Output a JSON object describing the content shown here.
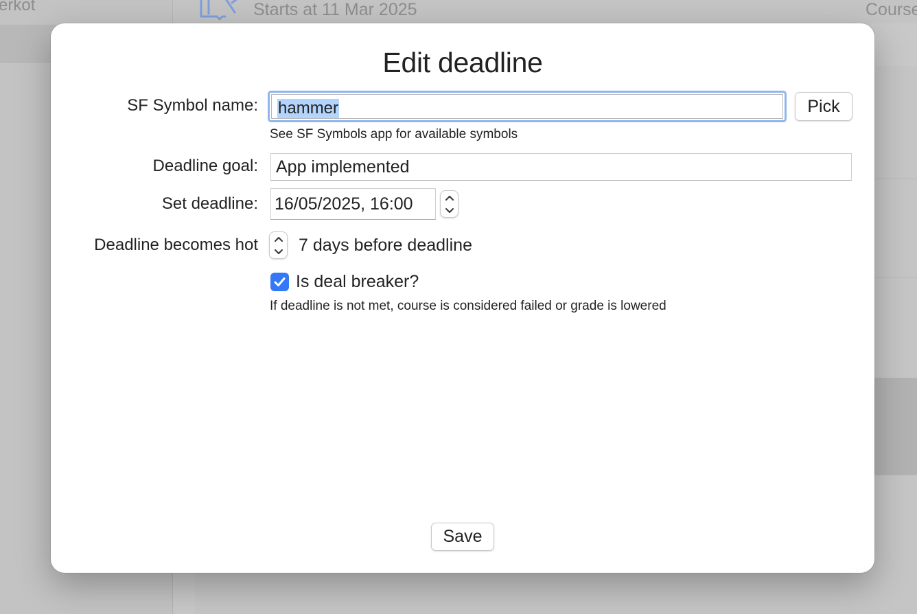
{
  "background": {
    "sidebar_text": "erkot",
    "starts_text": "Starts at 11 Mar 2025",
    "course_text": "Course",
    "course_icon": "book-wrench-icon"
  },
  "dialog": {
    "title": "Edit deadline",
    "symbol": {
      "label": "SF Symbol name:",
      "value": "hammer",
      "pick_label": "Pick",
      "hint": "See SF Symbols app for available symbols"
    },
    "goal": {
      "label": "Deadline goal:",
      "value": "App implemented"
    },
    "deadline": {
      "label": "Set deadline:",
      "value": "16/05/2025, 16:00"
    },
    "hot": {
      "label": "Deadline becomes hot",
      "value": "7 days before deadline"
    },
    "deal_breaker": {
      "label": "Is deal breaker?",
      "checked": true,
      "hint": "If deadline is not met, course is considered failed or grade is lowered"
    },
    "save_label": "Save"
  },
  "colors": {
    "accent": "#3478f6",
    "focus_ring": "#8fb4ef",
    "selection": "#b3d4fc"
  }
}
